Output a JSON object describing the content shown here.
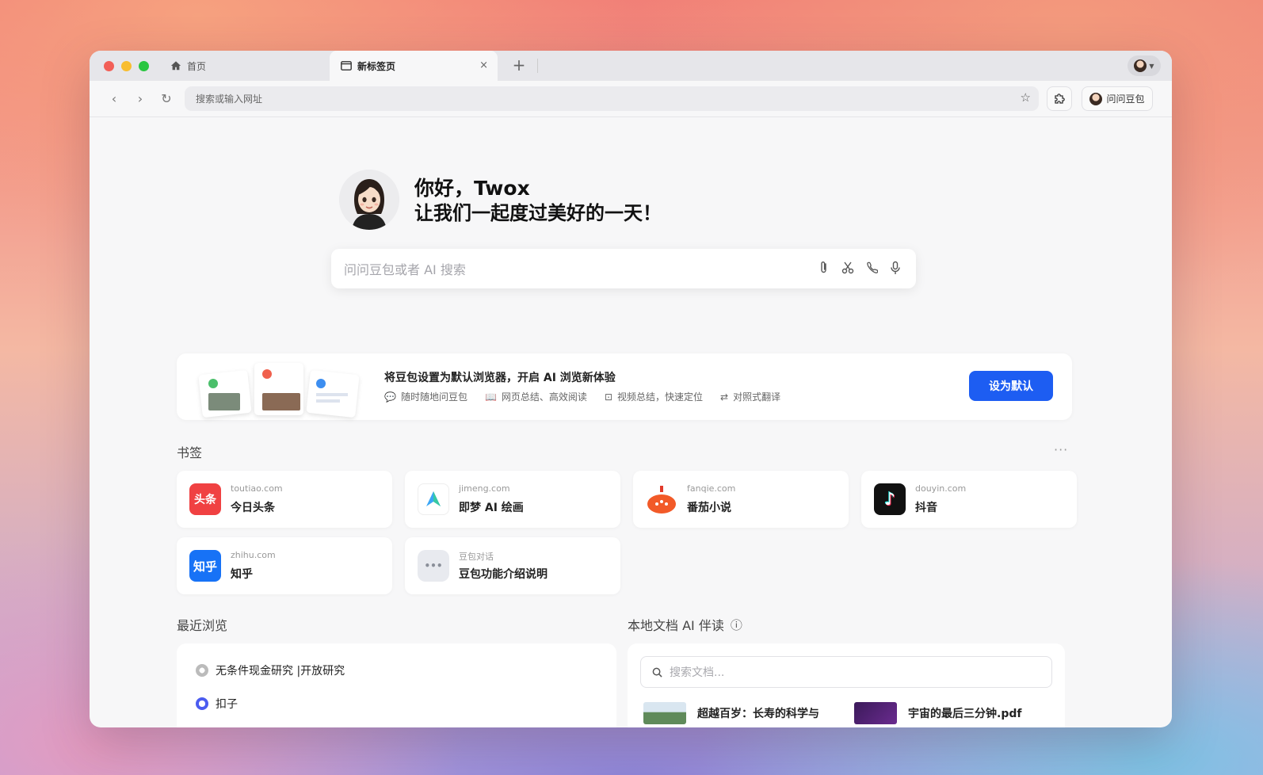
{
  "tabs": {
    "home_label": "首页",
    "active_label": "新标签页",
    "close_glyph": "×",
    "new_tab_glyph": "+"
  },
  "toolbar": {
    "back_glyph": "‹",
    "forward_glyph": "›",
    "reload_glyph": "↻",
    "omnibox_placeholder": "搜索或输入网址",
    "ask_label": "问问豆包"
  },
  "greeting": {
    "line1": "你好，Twox",
    "line2": "让我们一起度过美好的一天！"
  },
  "search": {
    "placeholder": "问问豆包或者 AI 搜索",
    "icons": [
      "paperclip-icon",
      "scissors-icon",
      "phone-icon",
      "microphone-icon"
    ]
  },
  "banner": {
    "title": "将豆包设置为默认浏览器，开启 AI 浏览新体验",
    "features": [
      {
        "icon": "chat-bubble-icon",
        "label": "随时随地问豆包"
      },
      {
        "icon": "book-icon",
        "label": "网页总结、高效阅读"
      },
      {
        "icon": "video-icon",
        "label": "视频总结，快速定位"
      },
      {
        "icon": "translate-icon",
        "label": "对照式翻译"
      }
    ],
    "button_label": "设为默认"
  },
  "bookmarks": {
    "title": "书签",
    "more_glyph": "···",
    "items": [
      {
        "domain": "toutiao.com",
        "name": "今日头条",
        "icon_text": "头条",
        "color": "#f04142"
      },
      {
        "domain": "jimeng.com",
        "name": "即梦 AI 绘画",
        "icon_text": "",
        "color": "#3aa6f5"
      },
      {
        "domain": "fanqie.com",
        "name": "番茄小说",
        "icon_text": "",
        "color": "#f25a28"
      },
      {
        "domain": "douyin.com",
        "name": "抖音",
        "icon_text": "♪",
        "color": "#111111"
      },
      {
        "domain": "zhihu.com",
        "name": "知乎",
        "icon_text": "知乎",
        "color": "#1772f6"
      },
      {
        "domain": "豆包对话",
        "name": "豆包功能介绍说明",
        "icon_text": "•••",
        "color": "#e8eaef"
      }
    ]
  },
  "recent": {
    "title": "最近浏览",
    "items": [
      {
        "label": "无条件现金研究 |开放研究"
      },
      {
        "label": "扣子"
      }
    ]
  },
  "docs": {
    "title": "本地文档 AI 伴读",
    "info_glyph": "ⓘ",
    "search_placeholder": "搜索文档...",
    "items": [
      {
        "label": "超越百岁：长寿的科学与"
      },
      {
        "label": "宇宙的最后三分钟.pdf"
      }
    ]
  },
  "colors": {
    "accent": "#1d5df2",
    "window_bg": "#f7f7f8"
  }
}
